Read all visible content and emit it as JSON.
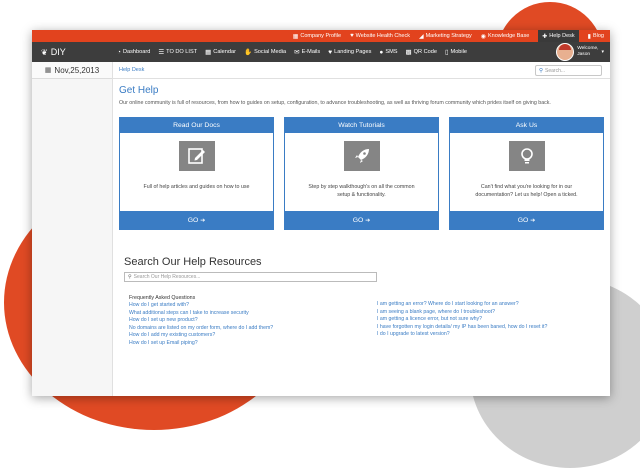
{
  "topbar": {
    "links": [
      {
        "icon": "company-icon",
        "glyph": "▦",
        "label": "Company Profile"
      },
      {
        "icon": "heart-pulse-icon",
        "glyph": "♥",
        "label": "Website Health Check"
      },
      {
        "icon": "megaphone-icon",
        "glyph": "◢",
        "label": "Marketing Strategy"
      },
      {
        "icon": "lightbulb-icon",
        "glyph": "◉",
        "label": "Knowledge Base"
      },
      {
        "icon": "lifebuoy-icon",
        "glyph": "✚",
        "label": "Help Desk",
        "active": true
      },
      {
        "icon": "chat-icon",
        "glyph": "▮",
        "label": "Blog"
      }
    ]
  },
  "nav": {
    "logo_glyph": "❦",
    "logo": "DIY",
    "links": [
      {
        "icon": "dashboard-icon",
        "glyph": "◔",
        "label": "Dashboard"
      },
      {
        "icon": "list-icon",
        "glyph": "☰",
        "label": "TO DO LIST"
      },
      {
        "icon": "calendar-icon",
        "glyph": "▦",
        "label": "Calendar"
      },
      {
        "icon": "thumbs-up-icon",
        "glyph": "✋",
        "label": "Social Media"
      },
      {
        "icon": "envelope-icon",
        "glyph": "✉",
        "label": "E-Mails"
      },
      {
        "icon": "heart-icon",
        "glyph": "♥",
        "label": "Landing Pages"
      },
      {
        "icon": "comment-icon",
        "glyph": "●",
        "label": "SMS"
      },
      {
        "icon": "qrcode-icon",
        "glyph": "▩",
        "label": "QR Code"
      },
      {
        "icon": "mobile-icon",
        "glyph": "▯",
        "label": "Mobile"
      }
    ],
    "user": {
      "welcome": "Welcome,",
      "name": "Jason",
      "caret": "▾"
    }
  },
  "sidebar": {
    "date_glyph": "▦",
    "date": "Nov,25,2013"
  },
  "breadcrumb": "Help Desk",
  "search": {
    "glyph": "⚲",
    "placeholder": "Search..."
  },
  "page": {
    "title": "Get Help",
    "intro": "Our online community is full of resources, from how to guides on setup, configuration, to advance troubleshooting, as well as thriving forum community which prides itself on giving back."
  },
  "cards": [
    {
      "title": "Read Our Docs",
      "icon": "edit-icon",
      "text": "Full of help articles and guides on how to use",
      "go": "GO",
      "go_glyph": "➔"
    },
    {
      "title": "Watch Tutorials",
      "icon": "rocket-icon",
      "text": "Step by step walkthough's on all the common setup & functionality.",
      "go": "GO",
      "go_glyph": "➔"
    },
    {
      "title": "Ask Us",
      "icon": "lightbulb-icon",
      "text": "Can't find what you're looking for in our documentation? Let us help! Open a ticked.",
      "go": "GO",
      "go_glyph": "➔"
    }
  ],
  "help_search": {
    "title": "Search Our Help Resources",
    "glyph": "⚲",
    "placeholder": "Search Our Help Resources..."
  },
  "faq": {
    "heading": "Frequently Asked Questions",
    "col1": [
      "How do I get started with?",
      "What additional steps can I take to increase security",
      "How do I set up new product?",
      "No domains are listed on my order form, where do I add them?",
      "How do I add my existing customers?",
      "How do I set up Email piping?"
    ],
    "col2": [
      "I am getting an error? Where do I start looking for an answer?",
      "I am seeing a blank page, where do I troubleshoot?",
      "I am getting a licence error, but not sure why?",
      "I have forgotten my login details/ my IP has been baned, how do I reset it?",
      "I do I upgrade to latest version?"
    ]
  }
}
